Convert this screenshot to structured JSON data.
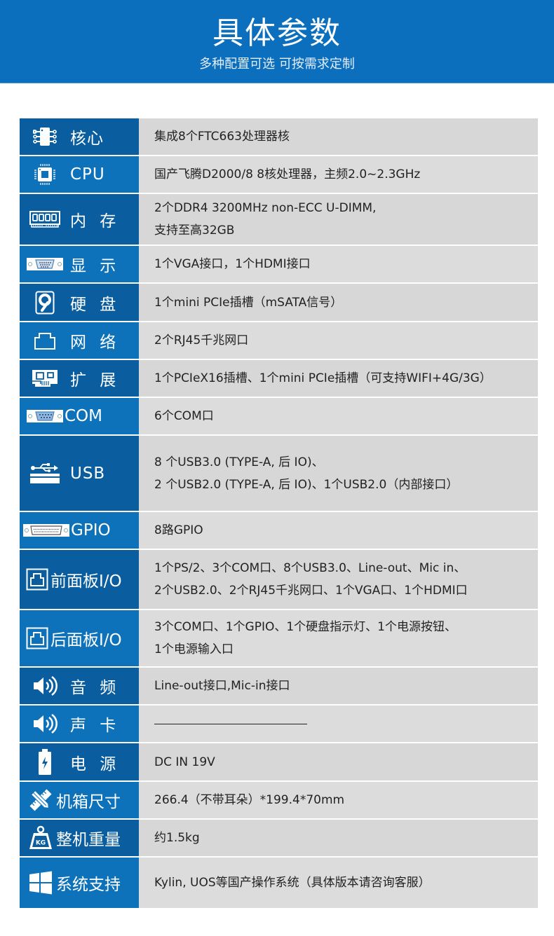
{
  "header": {
    "title": "具体参数",
    "subtitle": "多种配置可选 可按需求定制"
  },
  "colors": {
    "header_blue": "#0b6fbd",
    "label_dark": "#0a5d9f",
    "label_light": "#0e72bb",
    "value_bg": "#d9d9d9",
    "text": "#222222"
  },
  "specs": [
    {
      "label": "核心",
      "icon": "chip-icon",
      "lines": [
        "集成8个FTC663处理器核"
      ]
    },
    {
      "label": "CPU",
      "icon": "cpu-icon",
      "lines": [
        "国产飞腾D2000/8  8核处理器，主频2.0~2.3GHz"
      ]
    },
    {
      "label": "内 存",
      "icon": "memory-module-icon",
      "lines": [
        "2个DDR4 3200MHz non-ECC U-DIMM,",
        "支持至高32GB"
      ]
    },
    {
      "label": "显 示",
      "icon": "vga-port-icon",
      "lines": [
        "1个VGA接口，1个HDMI接口"
      ]
    },
    {
      "label": "硬 盘",
      "icon": "hard-disk-icon",
      "lines": [
        "1个mini PCIe插槽（mSATA信号）"
      ]
    },
    {
      "label": "网 络",
      "icon": "ethernet-port-icon",
      "lines": [
        "2个RJ45千兆网口"
      ]
    },
    {
      "label": "扩 展",
      "icon": "expansion-card-icon",
      "lines": [
        "1个PCIeX16插槽、1个mini PCIe插槽（可支持WIFI+4G/3G）"
      ]
    },
    {
      "label": "COM",
      "icon": "serial-port-icon",
      "lines": [
        "6个COM口"
      ]
    },
    {
      "label": "USB",
      "icon": "usb-icon",
      "lines": [
        "8 个USB3.0 (TYPE-A, 后 IO)、",
        "2 个USB2.0 (TYPE-A, 后 IO)、1个USB2.0（内部接口）"
      ]
    },
    {
      "label": "GPIO",
      "icon": "gpio-connector-icon",
      "lines": [
        "8路GPIO"
      ]
    },
    {
      "label": "前面板I/O",
      "icon": "io-port-icon",
      "lines": [
        "1个PS/2、3个COM口、8个USB3.0、Line-out、Mic in、",
        "2个USB2.0、2个RJ45千兆网口、1个VGA口、1个HDMI口"
      ]
    },
    {
      "label": "后面板I/O",
      "icon": "io-port-icon",
      "lines": [
        "3个COM口、1个GPIO、1个硬盘指示灯、1个电源按钮、",
        "1个电源输入口"
      ]
    },
    {
      "label": "音 频",
      "icon": "speaker-icon",
      "lines": [
        "Line-out接口,Mic-in接口"
      ]
    },
    {
      "label": "声 卡",
      "icon": "speaker-icon",
      "lines": []
    },
    {
      "label": "电 源",
      "icon": "battery-icon",
      "lines": [
        "DC IN 19V"
      ]
    },
    {
      "label": "机箱尺寸",
      "icon": "ruler-pencil-icon",
      "lines": [
        "266.4（不带耳朵）*199.4*70mm"
      ]
    },
    {
      "label": "整机重量",
      "icon": "weight-kg-icon",
      "lines": [
        "约1.5kg"
      ]
    },
    {
      "label": "系统支持",
      "icon": "windows-icon",
      "lines": [
        "Kylin, UOS等国产操作系统（具体版本请咨询客服）"
      ]
    }
  ]
}
